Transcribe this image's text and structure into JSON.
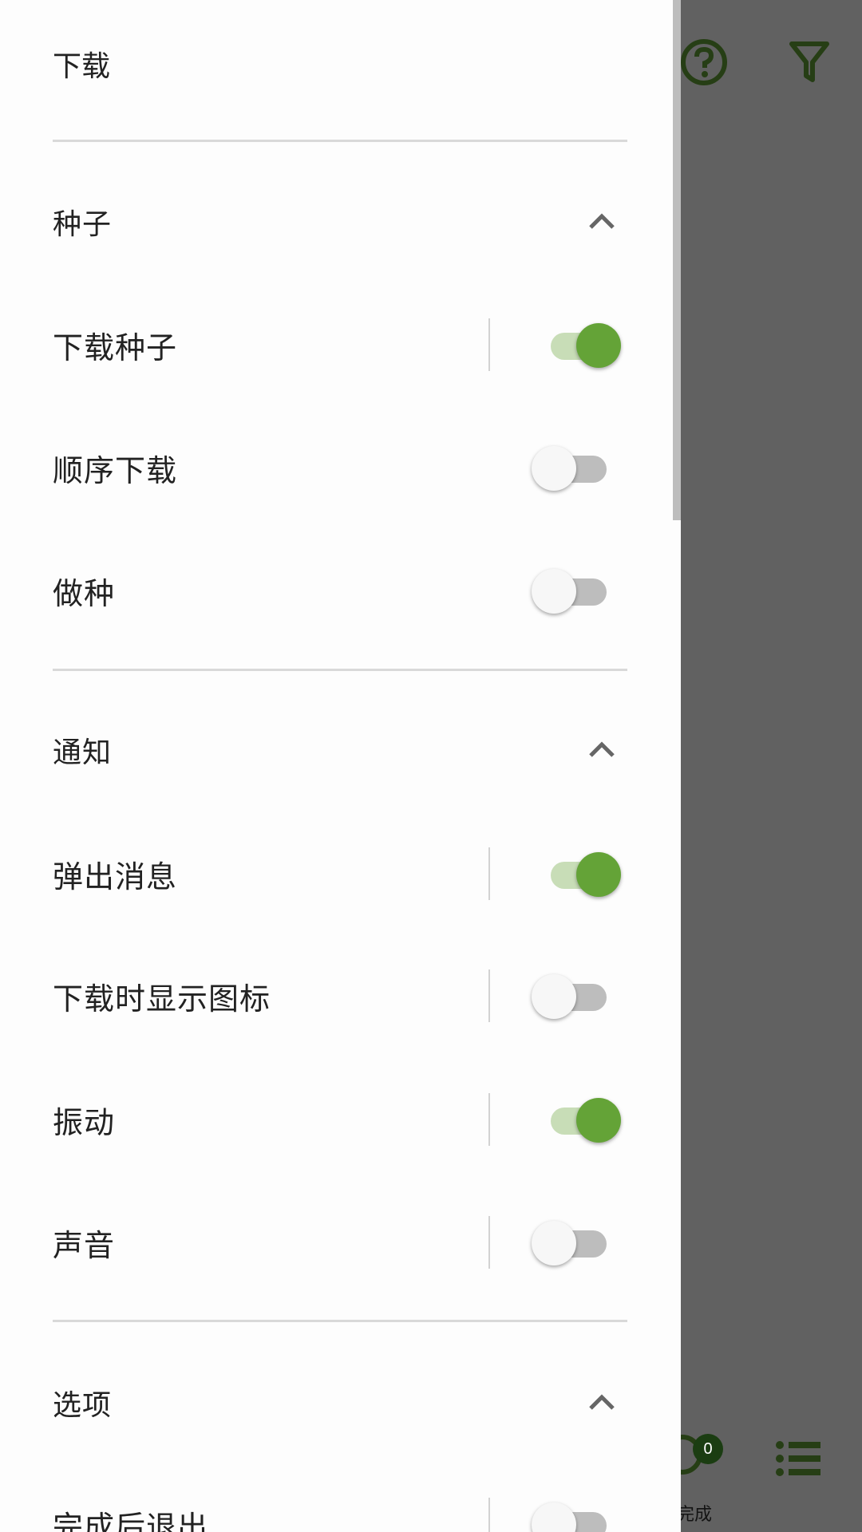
{
  "drawer": {
    "title": "下载",
    "sections": [
      {
        "title": "种子",
        "items": [
          {
            "label": "下载种子",
            "on": true
          },
          {
            "label": "顺序下载",
            "on": false
          },
          {
            "label": "做种",
            "on": false
          }
        ]
      },
      {
        "title": "通知",
        "items": [
          {
            "label": "弹出消息",
            "on": true
          },
          {
            "label": "下载时显示图标",
            "on": false
          },
          {
            "label": "振动",
            "on": true
          },
          {
            "label": "声音",
            "on": false
          }
        ]
      },
      {
        "title": "选项",
        "items": [
          {
            "label": "完成后退出",
            "on": false
          }
        ]
      }
    ]
  },
  "background": {
    "badge_count": "0",
    "bottom_nav_label": "完成"
  },
  "colors": {
    "accent": "#64a337",
    "dark_green": "#1b3d12",
    "scrim": "rgba(0,0,0,0.62)"
  },
  "icons": {
    "toolbar": [
      "stats-chart-icon",
      "eye-icon",
      "chevron-down-icon",
      "help-circle-icon",
      "filter-icon"
    ],
    "bottom_nav": [
      "completed-icon",
      "list-icon"
    ]
  }
}
